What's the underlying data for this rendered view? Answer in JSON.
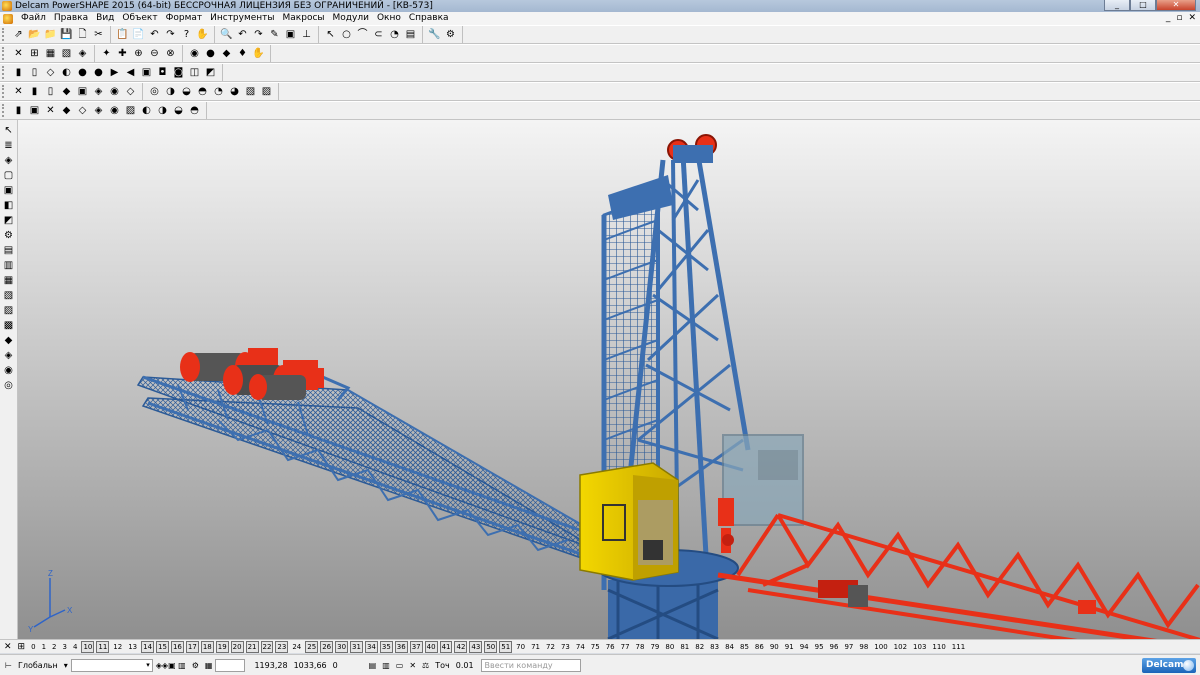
{
  "window": {
    "title": "Delcam PowerSHAPE 2015 (64-bit) БЕССРОЧНАЯ ЛИЦЕНЗИЯ БЕЗ ОГРАНИЧЕНИЙ - [КВ-573]",
    "minimize": "_",
    "maximize": "□",
    "close": "✕"
  },
  "menu": {
    "items": [
      "Файл",
      "Правка",
      "Вид",
      "Объект",
      "Формат",
      "Инструменты",
      "Макросы",
      "Модули",
      "Окно",
      "Справка"
    ],
    "mdi_controls": [
      "_",
      "▫",
      "✕"
    ]
  },
  "toolbars": {
    "row1": [
      "⇗",
      "📂",
      "📁",
      "💾",
      "🗋",
      "✂",
      "📋",
      "📄",
      "↶",
      "↷",
      "?",
      "✋",
      "🔍",
      "↶",
      "↷",
      "✎",
      "▣",
      "⊥",
      "↖",
      "○",
      "⌒",
      "⊂",
      "◔",
      "▤",
      "🔧",
      "⚙"
    ],
    "row2": [
      "✕",
      "⊞",
      "▦",
      "▧",
      "◈",
      "✦",
      "✚",
      "⊕",
      "⊖",
      "⊗",
      "◉",
      "●",
      "◆",
      "♦",
      "✋"
    ],
    "row3": [
      "▮",
      "▯",
      "◇",
      "◐",
      "●",
      "●",
      "▶",
      "◀",
      "▣",
      "◘",
      "◙",
      "◫",
      "◩"
    ],
    "row4": [
      "✕",
      "▮",
      "▯",
      "◆",
      "▣",
      "◈",
      "◉",
      "◇",
      "◎",
      "◑",
      "◒",
      "◓",
      "◔",
      "◕",
      "▧",
      "▨"
    ],
    "row5": [
      "▮",
      "▣",
      "✕",
      "◆",
      "◇",
      "◈",
      "◉",
      "▨",
      "◐",
      "◑",
      "◒",
      "◓"
    ]
  },
  "left_toolbar": [
    "↖",
    "≣",
    "◈",
    "▢",
    "▣",
    "◧",
    "◩",
    "⚙",
    "▤",
    "▥",
    "▦",
    "▧",
    "▨",
    "▩",
    "◆",
    "◈",
    "◉",
    "◎"
  ],
  "layers": [
    "0",
    "1",
    "2",
    "3",
    "4",
    "10",
    "11",
    "12",
    "13",
    "14",
    "15",
    "16",
    "17",
    "18",
    "19",
    "20",
    "21",
    "22",
    "23",
    "24",
    "25",
    "26",
    "30",
    "31",
    "34",
    "35",
    "36",
    "37",
    "40",
    "41",
    "42",
    "43",
    "50",
    "51",
    "70",
    "71",
    "72",
    "73",
    "74",
    "75",
    "76",
    "77",
    "78",
    "79",
    "80",
    "81",
    "82",
    "83",
    "84",
    "85",
    "86",
    "90",
    "91",
    "94",
    "95",
    "96",
    "97",
    "98",
    "100",
    "102",
    "103",
    "110",
    "111"
  ],
  "boxed_layers": [
    "10",
    "11",
    "14",
    "15",
    "16",
    "17",
    "18",
    "19",
    "20",
    "21",
    "22",
    "23",
    "25",
    "26",
    "30",
    "31",
    "34",
    "35",
    "36",
    "37",
    "40",
    "41",
    "42",
    "43",
    "50",
    "51"
  ],
  "status": {
    "workplane": "Глобальн",
    "coord_x": "1193,28",
    "coord_y": "1033,66",
    "coord_z": "0",
    "tolerance_label": "Точ",
    "tolerance_value": "0.01",
    "command_placeholder": "Ввести команду",
    "logo": "Delcam"
  },
  "axis": {
    "x": "X",
    "y": "Y",
    "z": "Z"
  },
  "colors": {
    "mast_blue": "#3d6fb0",
    "boom_red": "#e83018",
    "cab_yellow": "#f0d200",
    "counterweight_gray": "#8aa7b8"
  }
}
